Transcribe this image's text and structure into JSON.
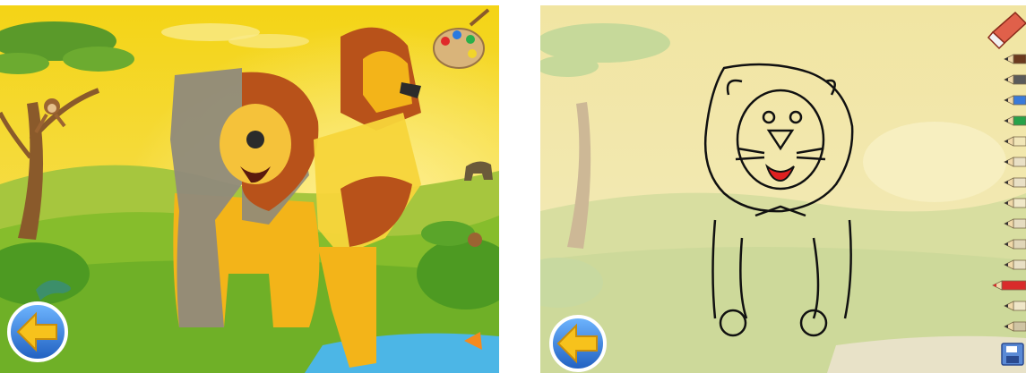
{
  "screens": [
    {
      "id": "puzzle",
      "subject": "lion",
      "tools": [
        "palette-icon",
        "back-arrow-icon"
      ],
      "colors": {
        "sky": "#f5d21a",
        "hills": "#9cc23a",
        "grass": "#7cbf2a",
        "lion_body": "#f3b419",
        "mane": "#b8521a",
        "unsolved_piece": "#8f8a7b",
        "water": "#4cb6e6",
        "back_button": "#2f7fd6",
        "arrow": "#f7c21c"
      }
    },
    {
      "id": "coloring",
      "subject": "lion outline",
      "tools": [
        "eraser-icon",
        "pencil-icon",
        "save-icon",
        "back-arrow-icon"
      ],
      "selected_pencil": "red",
      "palette": [
        "#6b3a1f",
        "#5a5a5a",
        "#3a7ad9",
        "#27a24a",
        "#f1e6b8",
        "#e9e0c6",
        "#e9e0c6",
        "#f0e8c8",
        "#e5dcc0",
        "#e0d6b8",
        "#e8dfc4",
        "#d92b2b",
        "#efe6c8",
        "#cfc4a4"
      ],
      "colors": {
        "faded_bg": "#efe4a8",
        "outline": "#111111",
        "mouth_fill": "#e02020",
        "back_button": "#2f7fd6",
        "arrow": "#f7c21c"
      }
    }
  ]
}
